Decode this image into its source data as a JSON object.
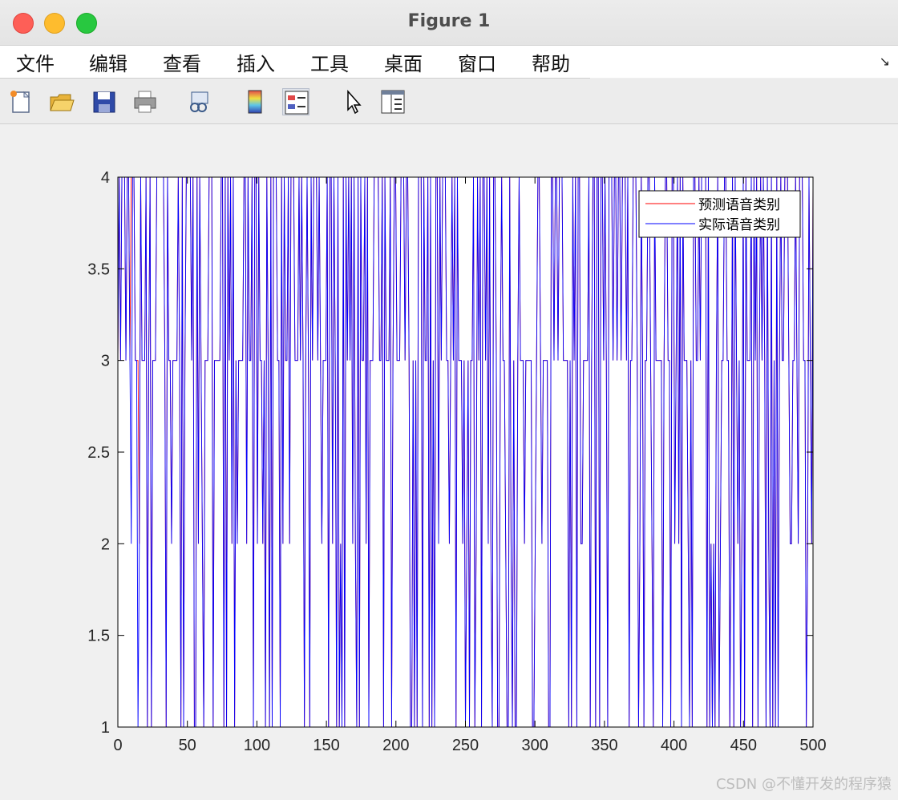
{
  "window": {
    "title": "Figure 1"
  },
  "menu": {
    "items": [
      "文件",
      "编辑",
      "查看",
      "插入",
      "工具",
      "桌面",
      "窗口",
      "帮助"
    ],
    "overflow_symbol": "↘"
  },
  "toolbar": {
    "icons": [
      "new-figure-icon",
      "open-file-icon",
      "save-icon",
      "print-icon",
      "link-plot-icon",
      "colorbar-icon",
      "legend-icon",
      "pointer-icon",
      "property-inspector-icon"
    ]
  },
  "watermark": "CSDN @不懂开发的程序猿",
  "colors": {
    "predicted": "#ff0000",
    "actual": "#0000ff",
    "axes": "#000000",
    "plot_bg": "#ffffff",
    "figure_bg": "#f0f0f0"
  },
  "chart_data": {
    "type": "line",
    "title": "",
    "xlabel": "",
    "ylabel": "",
    "xlim": [
      0,
      500
    ],
    "ylim": [
      1,
      4
    ],
    "xticks": [
      0,
      50,
      100,
      150,
      200,
      250,
      300,
      350,
      400,
      450,
      500
    ],
    "xtick_labels": [
      "0",
      "50",
      "100",
      "150",
      "200",
      "250",
      "300",
      "350",
      "400",
      "450",
      "500"
    ],
    "yticks": [
      1,
      1.5,
      2,
      2.5,
      3,
      3.5,
      4
    ],
    "ytick_labels": [
      "1",
      "1.5",
      "2",
      "2.5",
      "3",
      "3.5",
      "4"
    ],
    "grid": false,
    "legend_position": "top-right",
    "series": [
      {
        "name": "预测语音类别",
        "color": "#ff0000",
        "values": [
          3,
          4,
          3,
          4,
          4,
          4,
          3,
          4,
          4,
          3,
          4,
          4,
          4,
          3,
          3,
          3,
          2,
          4,
          3,
          3,
          3,
          4,
          1,
          3,
          4,
          1,
          3,
          3,
          3,
          4,
          4,
          4,
          4,
          4,
          4,
          3,
          1,
          4,
          3,
          3,
          2,
          3,
          3,
          3,
          3,
          4,
          3,
          1,
          4,
          1,
          3,
          4,
          4,
          4,
          4,
          3,
          4,
          1,
          1,
          4,
          2,
          4,
          3,
          2,
          1,
          3,
          3,
          3,
          4,
          4,
          4,
          1,
          3,
          3,
          3,
          3,
          3,
          4,
          4,
          1,
          4,
          1,
          4,
          3,
          4,
          2,
          4,
          1,
          3,
          2,
          3,
          3,
          3,
          3,
          4,
          4,
          2,
          4,
          3,
          3,
          4,
          1,
          4,
          4,
          2,
          4,
          3,
          3,
          2,
          3,
          1,
          4,
          3,
          1,
          4,
          1,
          4,
          4,
          4,
          3,
          3,
          1,
          4,
          2,
          4,
          3,
          3,
          4,
          2,
          4,
          4,
          4,
          3,
          3,
          3,
          4,
          3,
          4,
          3,
          1,
          3,
          4,
          3,
          1,
          4,
          3,
          4,
          4,
          4,
          3,
          4,
          3,
          2,
          3,
          3,
          3,
          4,
          1,
          4,
          4,
          2,
          4,
          3,
          1,
          4,
          1,
          2,
          1,
          4,
          1,
          4,
          3,
          4,
          3,
          4,
          2,
          4,
          2,
          1,
          4,
          1,
          4,
          3,
          3,
          4,
          2,
          4,
          1,
          3,
          3,
          3,
          4,
          4,
          4,
          4,
          3,
          3,
          4,
          1,
          4,
          3,
          3,
          3,
          4,
          1,
          3,
          4,
          4,
          3,
          3,
          3,
          4,
          4,
          4,
          3,
          4,
          4,
          3,
          1,
          1,
          3,
          1,
          3,
          1,
          4,
          4,
          4,
          1,
          4,
          3,
          3,
          4,
          1,
          4,
          1,
          3,
          1,
          4,
          4,
          2,
          4,
          3,
          4,
          4,
          4,
          3,
          3,
          2,
          3,
          4,
          3,
          4,
          1,
          4,
          3,
          3,
          3,
          2,
          3,
          1,
          2,
          3,
          1,
          3,
          3,
          4,
          1,
          2,
          4,
          3,
          4,
          1,
          4,
          4,
          3,
          4,
          2,
          4,
          2,
          1,
          4,
          4,
          3,
          1,
          1,
          3,
          4,
          3,
          3,
          2,
          1,
          1,
          4,
          2,
          1,
          3,
          1,
          1,
          3,
          4,
          3,
          3,
          3,
          2,
          3,
          3,
          3,
          3,
          3,
          1,
          1,
          2,
          3,
          4,
          4,
          3,
          2,
          3,
          3,
          3,
          3,
          1,
          1,
          4,
          4,
          3,
          4,
          4,
          3,
          4,
          4,
          4,
          3,
          3,
          3,
          3,
          1,
          3,
          1,
          4,
          3,
          4,
          1,
          4,
          4,
          2,
          2,
          3,
          3,
          3,
          3,
          4,
          1,
          3,
          4,
          4,
          1,
          4,
          4,
          1,
          4,
          4,
          3,
          4,
          3,
          1,
          4,
          4,
          4,
          3,
          4,
          4,
          3,
          4,
          4,
          3,
          4,
          4,
          4,
          3,
          4,
          1,
          3,
          3,
          4,
          4,
          4,
          3,
          1,
          2,
          4,
          3,
          1,
          3,
          3,
          4,
          4,
          3,
          2,
          1,
          4,
          3,
          3,
          3,
          3,
          3,
          1,
          3,
          4,
          4,
          3,
          3,
          1,
          4,
          4,
          2,
          3,
          4,
          2,
          4,
          1,
          4,
          3,
          3,
          3,
          2,
          1,
          3,
          1,
          4,
          4,
          3,
          3,
          4,
          3,
          4,
          4,
          4,
          4,
          1,
          4,
          1,
          2,
          1,
          2,
          1,
          3,
          4,
          1,
          2,
          3,
          3,
          4,
          4,
          3,
          3,
          1,
          2,
          4,
          1,
          4,
          3,
          2,
          3,
          1,
          2,
          4,
          1,
          4,
          3,
          3,
          3,
          4,
          1,
          4,
          3,
          4,
          1,
          3,
          4,
          3,
          4,
          3,
          1,
          4,
          2,
          1,
          4,
          1,
          3,
          1,
          4,
          1,
          3,
          4,
          3,
          3,
          4,
          4,
          4,
          3,
          2,
          2,
          3,
          3,
          4,
          3,
          2,
          4,
          4,
          4,
          3,
          3,
          1,
          2,
          4,
          3,
          2,
          4
        ]
      },
      {
        "name": "实际语音类别",
        "color": "#0000ff",
        "values": [
          3,
          4,
          3,
          4,
          4,
          4,
          3,
          4,
          4,
          3,
          2,
          4,
          4,
          3,
          3,
          1,
          2,
          4,
          3,
          3,
          3,
          4,
          1,
          3,
          4,
          1,
          3,
          3,
          3,
          4,
          4,
          4,
          4,
          4,
          4,
          3,
          1,
          4,
          3,
          3,
          2,
          3,
          3,
          3,
          3,
          4,
          3,
          1,
          4,
          1,
          3,
          4,
          4,
          4,
          4,
          3,
          4,
          1,
          1,
          4,
          2,
          4,
          3,
          2,
          1,
          3,
          3,
          3,
          4,
          4,
          4,
          1,
          3,
          3,
          3,
          3,
          3,
          4,
          4,
          1,
          4,
          1,
          4,
          3,
          4,
          2,
          4,
          1,
          3,
          2,
          3,
          3,
          3,
          3,
          4,
          4,
          2,
          4,
          3,
          3,
          4,
          1,
          4,
          4,
          2,
          4,
          3,
          3,
          2,
          3,
          1,
          4,
          3,
          1,
          4,
          1,
          4,
          4,
          4,
          3,
          3,
          1,
          4,
          2,
          4,
          3,
          3,
          4,
          2,
          4,
          4,
          4,
          3,
          3,
          3,
          4,
          3,
          4,
          3,
          1,
          3,
          4,
          3,
          1,
          4,
          3,
          4,
          4,
          4,
          3,
          4,
          3,
          2,
          3,
          3,
          3,
          4,
          1,
          4,
          4,
          2,
          4,
          3,
          1,
          4,
          1,
          2,
          1,
          4,
          1,
          4,
          3,
          4,
          3,
          4,
          2,
          4,
          2,
          1,
          4,
          1,
          4,
          3,
          3,
          4,
          2,
          4,
          1,
          3,
          3,
          3,
          4,
          4,
          4,
          4,
          3,
          3,
          4,
          1,
          4,
          3,
          3,
          3,
          4,
          1,
          3,
          4,
          4,
          3,
          3,
          3,
          4,
          4,
          4,
          3,
          4,
          4,
          3,
          1,
          1,
          3,
          1,
          3,
          1,
          4,
          4,
          4,
          1,
          4,
          3,
          3,
          4,
          1,
          4,
          1,
          3,
          1,
          4,
          4,
          2,
          4,
          3,
          4,
          4,
          4,
          3,
          3,
          2,
          3,
          4,
          3,
          4,
          1,
          4,
          3,
          3,
          3,
          2,
          3,
          1,
          2,
          3,
          1,
          3,
          3,
          4,
          1,
          2,
          4,
          3,
          4,
          1,
          4,
          4,
          3,
          4,
          2,
          4,
          2,
          1,
          4,
          4,
          3,
          1,
          1,
          3,
          4,
          3,
          3,
          2,
          1,
          1,
          4,
          2,
          1,
          3,
          1,
          1,
          3,
          4,
          3,
          3,
          3,
          2,
          3,
          3,
          3,
          3,
          3,
          1,
          1,
          2,
          3,
          4,
          4,
          3,
          2,
          3,
          3,
          3,
          3,
          1,
          1,
          4,
          4,
          3,
          4,
          4,
          3,
          4,
          4,
          4,
          3,
          3,
          3,
          3,
          1,
          3,
          1,
          4,
          3,
          4,
          1,
          4,
          4,
          2,
          2,
          3,
          3,
          3,
          3,
          4,
          1,
          3,
          4,
          4,
          1,
          4,
          4,
          1,
          4,
          4,
          3,
          4,
          3,
          1,
          4,
          4,
          4,
          3,
          4,
          4,
          3,
          4,
          4,
          3,
          4,
          4,
          4,
          3,
          4,
          1,
          3,
          3,
          4,
          4,
          4,
          3,
          1,
          2,
          4,
          3,
          1,
          3,
          3,
          4,
          4,
          3,
          2,
          1,
          4,
          3,
          3,
          3,
          3,
          3,
          1,
          3,
          4,
          4,
          3,
          3,
          1,
          4,
          4,
          2,
          3,
          4,
          2,
          4,
          1,
          4,
          3,
          3,
          3,
          2,
          1,
          3,
          1,
          4,
          4,
          3,
          3,
          4,
          3,
          4,
          4,
          4,
          4,
          1,
          4,
          1,
          2,
          1,
          2,
          1,
          3,
          4,
          1,
          2,
          3,
          3,
          4,
          4,
          3,
          3,
          1,
          2,
          4,
          1,
          4,
          3,
          2,
          3,
          1,
          2,
          4,
          1,
          4,
          3,
          3,
          3,
          4,
          1,
          4,
          3,
          4,
          1,
          3,
          4,
          3,
          4,
          3,
          1,
          4,
          2,
          1,
          4,
          1,
          3,
          1,
          4,
          1,
          3,
          4,
          3,
          3,
          4,
          4,
          4,
          3,
          2,
          2,
          3,
          3,
          4,
          3,
          2,
          4,
          4,
          4,
          3,
          3,
          1,
          2,
          4,
          3,
          2,
          4
        ]
      }
    ]
  }
}
